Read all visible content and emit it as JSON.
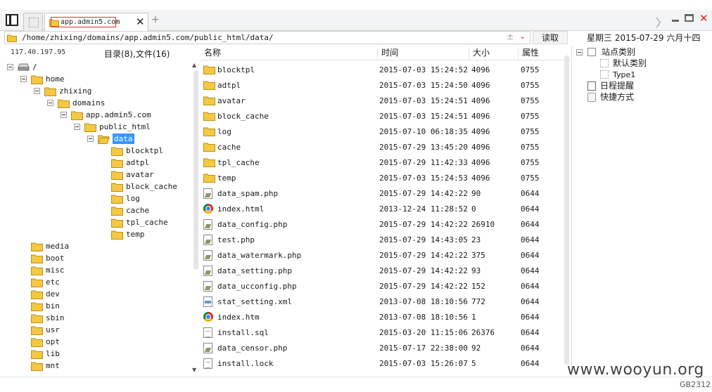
{
  "tabs": {
    "active_title": "app.admin5.com",
    "close_glyph": "✕",
    "new_tab_glyph": "+"
  },
  "window": {
    "nav_glyph": "〉",
    "close_glyph": "✕"
  },
  "address": {
    "path": "/home/zhixing/domains/app.admin5.com/public_html/data/",
    "plusminus": "±",
    "dropdown": "⌄",
    "read_button": "读取"
  },
  "date": "星期三 2015-07-29 六月十四",
  "tree": {
    "ip": "117.40.197.95",
    "summary": "目录(8),文件(16)",
    "nodes": [
      {
        "label": "/",
        "icon": "drive-icon"
      },
      {
        "label": "home"
      },
      {
        "label": "zhixing"
      },
      {
        "label": "domains"
      },
      {
        "label": "app.admin5.com"
      },
      {
        "label": "public_html"
      },
      {
        "label": "data",
        "selected": true
      },
      {
        "label": "blocktpl"
      },
      {
        "label": "adtpl"
      },
      {
        "label": "avatar"
      },
      {
        "label": "block_cache"
      },
      {
        "label": "log"
      },
      {
        "label": "cache"
      },
      {
        "label": "tpl_cache"
      },
      {
        "label": "temp"
      },
      {
        "label": "media"
      },
      {
        "label": "boot"
      },
      {
        "label": "misc"
      },
      {
        "label": "etc"
      },
      {
        "label": "dev"
      },
      {
        "label": "bin"
      },
      {
        "label": "sbin"
      },
      {
        "label": "usr"
      },
      {
        "label": "opt"
      },
      {
        "label": "lib"
      },
      {
        "label": "mnt"
      }
    ],
    "scroll_up": "▲",
    "scroll_down": "▼"
  },
  "files": {
    "columns": {
      "name": "名称",
      "time": "时间",
      "size": "大小",
      "perm": "属性"
    },
    "rows": [
      {
        "name": "blocktpl",
        "time": "2015-07-03 15:24:52",
        "size": "4096",
        "perm": "0755",
        "icon": "folder-icon"
      },
      {
        "name": "adtpl",
        "time": "2015-07-03 15:24:50",
        "size": "4096",
        "perm": "0755",
        "icon": "folder-icon"
      },
      {
        "name": "avatar",
        "time": "2015-07-03 15:24:51",
        "size": "4096",
        "perm": "0755",
        "icon": "folder-icon"
      },
      {
        "name": "block_cache",
        "time": "2015-07-03 15:24:51",
        "size": "4096",
        "perm": "0755",
        "icon": "folder-icon"
      },
      {
        "name": "log",
        "time": "2015-07-10 06:18:35",
        "size": "4096",
        "perm": "0755",
        "icon": "folder-icon"
      },
      {
        "name": "cache",
        "time": "2015-07-29 13:45:20",
        "size": "4096",
        "perm": "0755",
        "icon": "folder-icon"
      },
      {
        "name": "tpl_cache",
        "time": "2015-07-29 11:42:33",
        "size": "4096",
        "perm": "0755",
        "icon": "folder-icon"
      },
      {
        "name": "temp",
        "time": "2015-07-03 15:24:53",
        "size": "4096",
        "perm": "0755",
        "icon": "folder-icon"
      },
      {
        "name": "data_spam.php",
        "time": "2015-07-29 14:42:22",
        "size": "90",
        "perm": "0644",
        "icon": "php-file-icon"
      },
      {
        "name": "index.html",
        "time": "2013-12-24 11:28:52",
        "size": "0",
        "perm": "0644",
        "icon": "chrome-icon"
      },
      {
        "name": "data_config.php",
        "time": "2015-07-29 14:42:22",
        "size": "26910",
        "perm": "0644",
        "icon": "php-file-icon"
      },
      {
        "name": "test.php",
        "time": "2015-07-29 14:43:05",
        "size": "23",
        "perm": "0644",
        "icon": "php-file-icon"
      },
      {
        "name": "data_watermark.php",
        "time": "2015-07-29 14:42:22",
        "size": "375",
        "perm": "0644",
        "icon": "php-file-icon"
      },
      {
        "name": "data_setting.php",
        "time": "2015-07-29 14:42:22",
        "size": "93",
        "perm": "0644",
        "icon": "php-file-icon"
      },
      {
        "name": "data_ucconfig.php",
        "time": "2015-07-29 14:42:22",
        "size": "152",
        "perm": "0644",
        "icon": "php-file-icon"
      },
      {
        "name": "stat_setting.xml",
        "time": "2013-07-08 18:10:56",
        "size": "772",
        "perm": "0644",
        "icon": "xml-file-icon"
      },
      {
        "name": "index.htm",
        "time": "2013-07-08 18:10:56",
        "size": "1",
        "perm": "0644",
        "icon": "chrome-icon"
      },
      {
        "name": "install.sql",
        "time": "2015-03-20 11:15:06",
        "size": "26376",
        "perm": "0644",
        "icon": "document-icon"
      },
      {
        "name": "data_censor.php",
        "time": "2015-07-17 22:38:00",
        "size": "92",
        "perm": "0644",
        "icon": "php-file-icon"
      },
      {
        "name": "install.lock",
        "time": "2015-07-03 15:26:07",
        "size": "5",
        "perm": "0644",
        "icon": "document-icon"
      }
    ]
  },
  "right_panel": {
    "items": [
      {
        "label": "站点类别"
      },
      {
        "label": "默认类别"
      },
      {
        "label": "Type1"
      },
      {
        "label": "日程提醒"
      },
      {
        "label": "快捷方式"
      }
    ]
  },
  "watermark": "www.wooyun.org",
  "encoding": "GB2312",
  "colors": {
    "selection": "#3399ff",
    "folder": "#f5c842",
    "close": "#e0201c",
    "tab_highlight": "#e0302a"
  }
}
